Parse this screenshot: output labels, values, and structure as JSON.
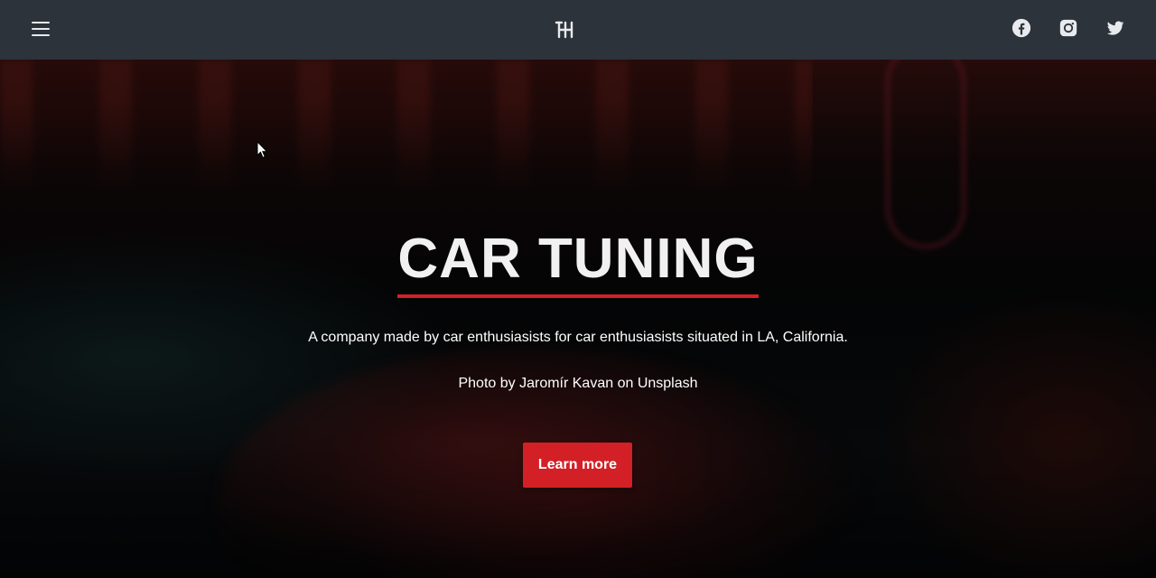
{
  "navbar": {
    "menu_icon": "hamburger-menu-icon",
    "logo_icon": "gear-shift-logo-icon",
    "socials": [
      {
        "name": "facebook",
        "icon": "facebook-icon"
      },
      {
        "name": "instagram",
        "icon": "instagram-icon"
      },
      {
        "name": "twitter",
        "icon": "twitter-icon"
      }
    ]
  },
  "hero": {
    "title": "CAR TUNING",
    "tagline": "A company made by car enthusiasists for car enthusiasists situated in LA, California.",
    "credit": "Photo by Jaromír Kavan on Unsplash",
    "cta_label": "Learn more"
  },
  "colors": {
    "navbar_bg": "#2c333b",
    "accent": "#d32027",
    "text": "#ffffff"
  }
}
